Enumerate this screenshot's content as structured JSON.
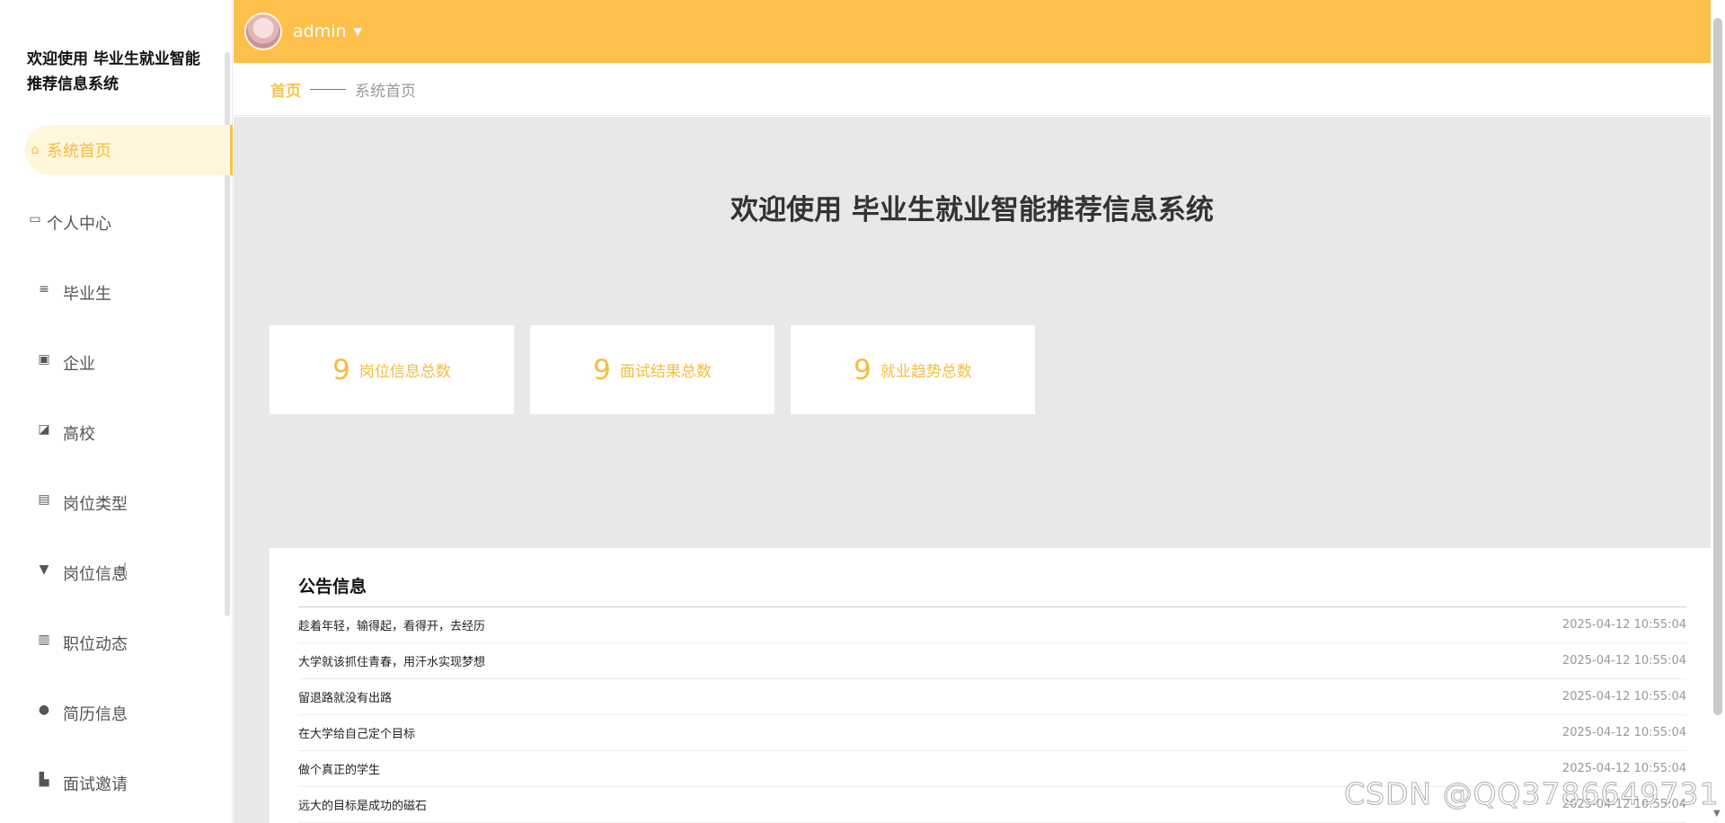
{
  "sidebar": {
    "brand": "欢迎使用 毕业生就业智能推荐信息系统",
    "items": [
      {
        "label": "系统首页",
        "icon": "home-icon"
      },
      {
        "label": "个人中心",
        "icon": "id-card-icon"
      },
      {
        "label": "毕业生",
        "icon": "menu-lines-icon"
      },
      {
        "label": "企业",
        "icon": "clipboard-icon"
      },
      {
        "label": "高校",
        "icon": "chart-icon"
      },
      {
        "label": "岗位类型",
        "icon": "clipboard-check-icon"
      },
      {
        "label": "岗位信息",
        "icon": "brush-icon"
      },
      {
        "label": "职位动态",
        "icon": "bar-chart-icon"
      },
      {
        "label": "简历信息",
        "icon": "bulb-icon"
      },
      {
        "label": "面试邀请",
        "icon": "books-icon"
      }
    ]
  },
  "header": {
    "username": "admin"
  },
  "breadcrumb": {
    "home": "首页",
    "current": "系统首页"
  },
  "main": {
    "welcome": "欢迎使用 毕业生就业智能推荐信息系统",
    "stats": [
      {
        "value": "9",
        "label": "岗位信息总数"
      },
      {
        "value": "9",
        "label": "面试结果总数"
      },
      {
        "value": "9",
        "label": "就业趋势总数"
      }
    ]
  },
  "notice": {
    "title": "公告信息",
    "items": [
      {
        "text": "趁着年轻，输得起，看得开，去经历",
        "date": "2025-04-12 10:55:04"
      },
      {
        "text": "大学就该抓住青春，用汗水实现梦想",
        "date": "2025-04-12 10:55:04"
      },
      {
        "text": "留退路就没有出路",
        "date": "2025-04-12 10:55:04"
      },
      {
        "text": "在大学给自己定个目标",
        "date": "2025-04-12 10:55:04"
      },
      {
        "text": "做个真正的学生",
        "date": "2025-04-12 10:55:04"
      },
      {
        "text": "远大的目标是成功的磁石",
        "date": "2025-04-12 10:55:04"
      }
    ]
  },
  "watermark": "CSDN @QQ3786649731",
  "colors": {
    "accent": "#fec04a",
    "accent_text": "#f5bd3e",
    "active_bg": "#fff6db",
    "main_bg": "#e8e8e8"
  }
}
